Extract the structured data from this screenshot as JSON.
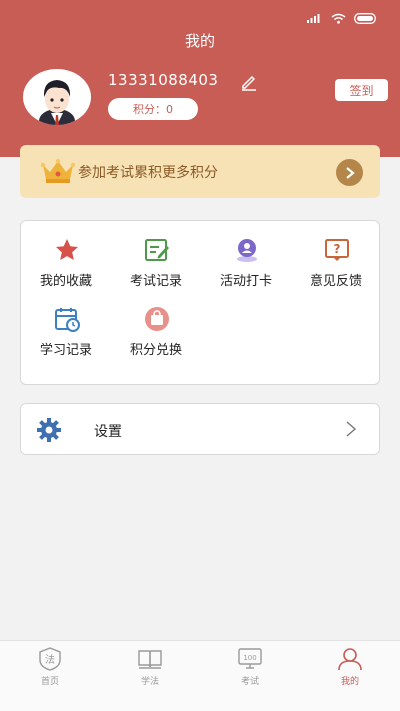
{
  "header": {
    "title": "我的",
    "phone": "13331088403",
    "points_label": "积分：0",
    "checkin_label": "签到"
  },
  "banner": {
    "text": "参加考试累积更多积分"
  },
  "grid": {
    "items": [
      {
        "label": "我的收藏",
        "icon": "star-icon"
      },
      {
        "label": "考试记录",
        "icon": "exam-record-icon"
      },
      {
        "label": "活动打卡",
        "icon": "checkin-pin-icon"
      },
      {
        "label": "意见反馈",
        "icon": "feedback-icon"
      },
      {
        "label": "学习记录",
        "icon": "calendar-icon"
      },
      {
        "label": "积分兑换",
        "icon": "gift-bag-icon"
      }
    ]
  },
  "settings": {
    "label": "设置"
  },
  "tabbar": {
    "tabs": [
      {
        "label": "首页",
        "icon": "law-seal-icon",
        "active": false
      },
      {
        "label": "学法",
        "icon": "book-icon",
        "active": false
      },
      {
        "label": "考试",
        "icon": "monitor-100-icon",
        "active": false
      },
      {
        "label": "我的",
        "icon": "user-icon",
        "active": true
      }
    ]
  },
  "colors": {
    "brand": "#c85d56",
    "banner_bg": "#f7e2b6",
    "banner_text": "#8a5a26",
    "icon_red": "#d8504a",
    "icon_green": "#4f9a4a",
    "icon_purple": "#7b68c8",
    "icon_blue": "#3e7fc1"
  }
}
